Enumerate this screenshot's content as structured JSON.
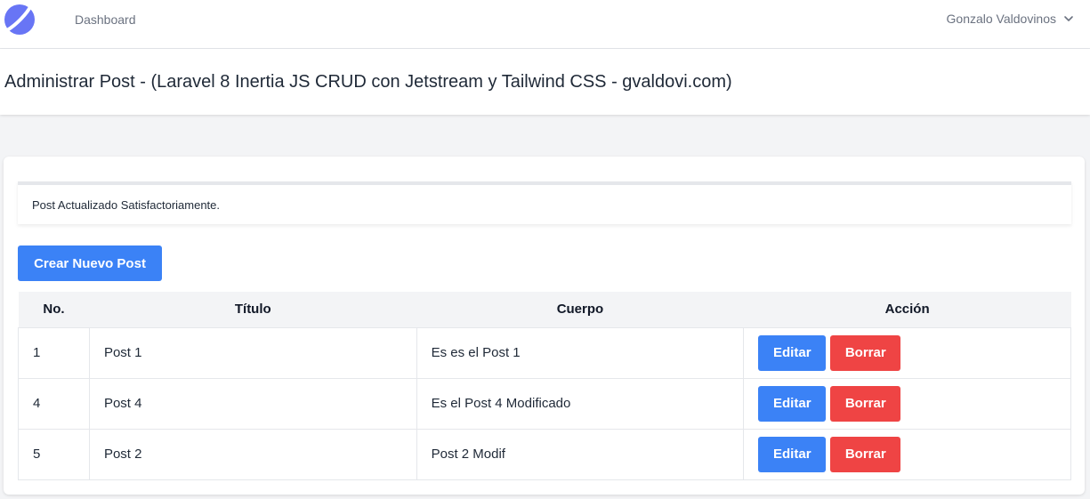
{
  "nav": {
    "logo": "jetstream-logo-icon",
    "dashboard_link": "Dashboard",
    "user_name": "Gonzalo Valdovinos",
    "user_menu_icon": "chevron-down-icon"
  },
  "header": {
    "title": "Administrar Post - (Laravel 8 Inertia JS CRUD con Jetstream y Tailwind CSS - gvaldovi.com)"
  },
  "flash": {
    "message": "Post Actualizado Satisfactoriamente."
  },
  "actions": {
    "create_label": "Crear Nuevo Post"
  },
  "table": {
    "columns": [
      "No.",
      "Título",
      "Cuerpo",
      "Acción"
    ],
    "rows": [
      {
        "id": "1",
        "title": "Post 1",
        "body": "Es es el Post 1",
        "edit_label": "Editar",
        "delete_label": "Borrar"
      },
      {
        "id": "4",
        "title": "Post 4",
        "body": "Es el Post 4 Modificado",
        "edit_label": "Editar",
        "delete_label": "Borrar"
      },
      {
        "id": "5",
        "title": "Post 2",
        "body": "Post 2 Modif",
        "edit_label": "Editar",
        "delete_label": "Borrar"
      }
    ]
  },
  "colors": {
    "primary": "#3b82f6",
    "danger": "#ef4444",
    "logo": "#6875f5",
    "background": "#f3f4f6"
  }
}
